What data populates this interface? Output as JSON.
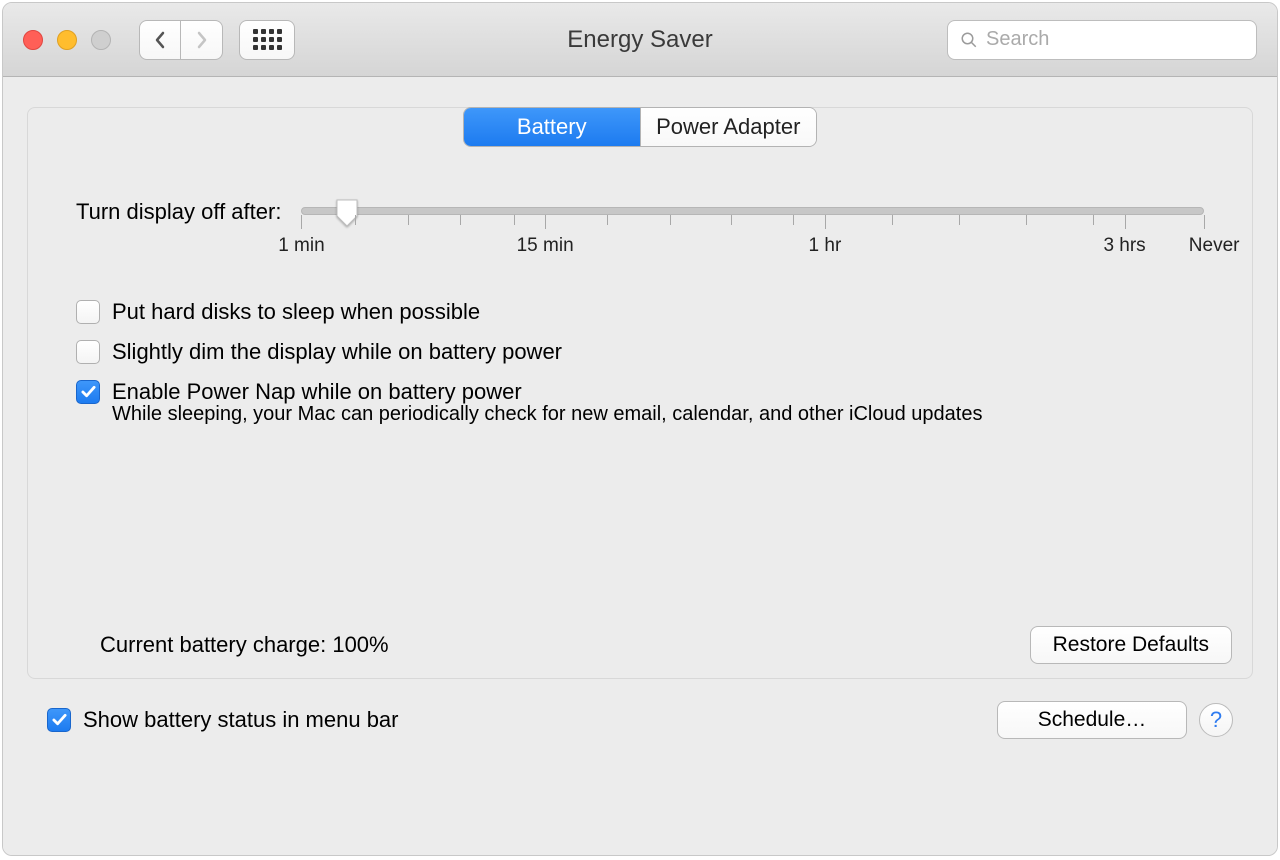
{
  "window": {
    "title": "Energy Saver"
  },
  "search": {
    "placeholder": "Search"
  },
  "tabs": {
    "battery": "Battery",
    "power_adapter": "Power Adapter"
  },
  "slider": {
    "label": "Turn display off after:",
    "ticks": [
      "1 min",
      "15 min",
      "1 hr",
      "3 hrs",
      "Never"
    ],
    "value_position_percent": 5
  },
  "checkboxes": {
    "hard_disks": {
      "label": "Put hard disks to sleep when possible",
      "checked": false
    },
    "dim_display": {
      "label": "Slightly dim the display while on battery power",
      "checked": false
    },
    "power_nap": {
      "label": "Enable Power Nap while on battery power",
      "checked": true,
      "description": "While sleeping, your Mac can periodically check for new email, calendar, and other iCloud updates"
    }
  },
  "battery_status": "Current battery charge: 100%",
  "buttons": {
    "restore_defaults": "Restore Defaults",
    "schedule": "Schedule…"
  },
  "footer_checkbox": {
    "label": "Show battery status in menu bar",
    "checked": true
  },
  "help_label": "?"
}
